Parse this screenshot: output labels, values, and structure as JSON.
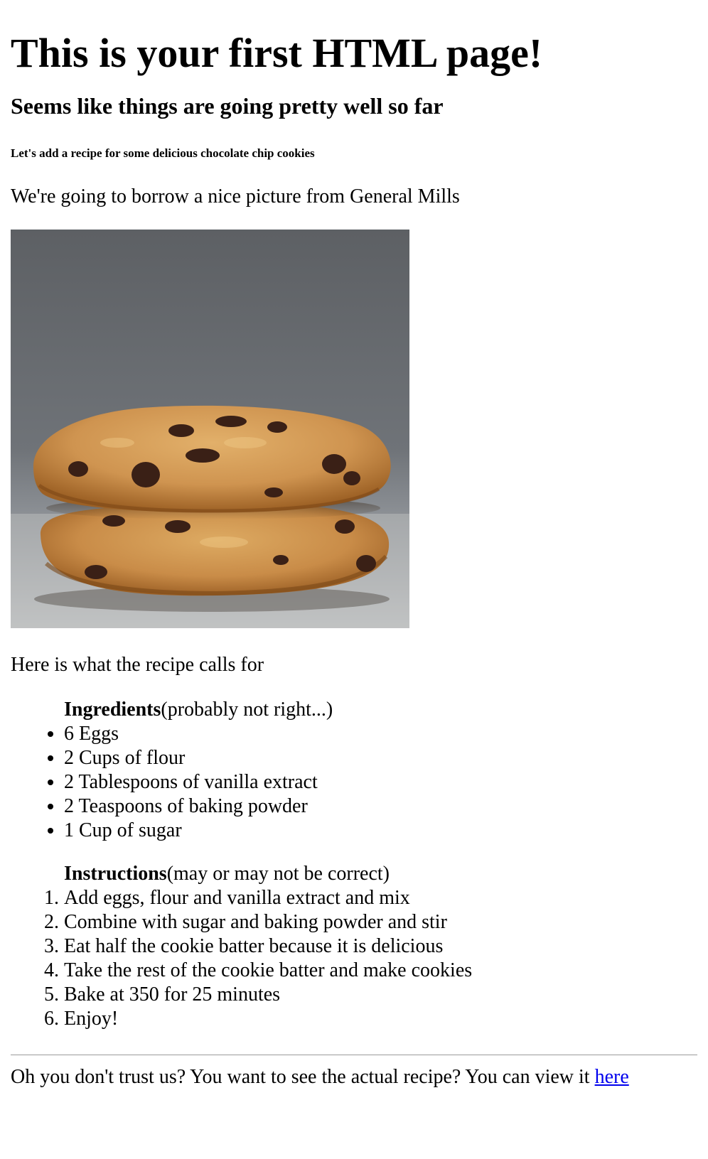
{
  "heading": {
    "title": "This is your first HTML page!",
    "subtitle": "Seems like things are going pretty well so far",
    "small": "Let's add a recipe for some delicious chocolate chip cookies"
  },
  "intro_text": "We're going to borrow a nice picture from General Mills",
  "image": {
    "alt": "Two stacked chocolate chip cookies"
  },
  "calls_for_text": "Here is what the recipe calls for",
  "ingredients": {
    "caption_bold": "Ingredients",
    "caption_note": "(probably not right...)",
    "items": [
      "6 Eggs",
      "2 Cups of flour",
      "2 Tablespoons of vanilla extract",
      "2 Teaspoons of baking powder",
      "1 Cup of sugar"
    ]
  },
  "instructions": {
    "caption_bold": "Instructions",
    "caption_note": "(may or may not be correct)",
    "steps": [
      "Add eggs, flour and vanilla extract and mix",
      "Combine with sugar and baking powder and stir",
      "Eat half the cookie batter because it is delicious",
      "Take the rest of the cookie batter and make cookies",
      "Bake at 350 for 25 minutes",
      "Enjoy!"
    ]
  },
  "footer": {
    "text": "Oh you don't trust us? You want to see the actual recipe? You can view it ",
    "link_label": "here"
  },
  "colors": {
    "link": "#0000ee",
    "rule": "#9a9a9a"
  }
}
